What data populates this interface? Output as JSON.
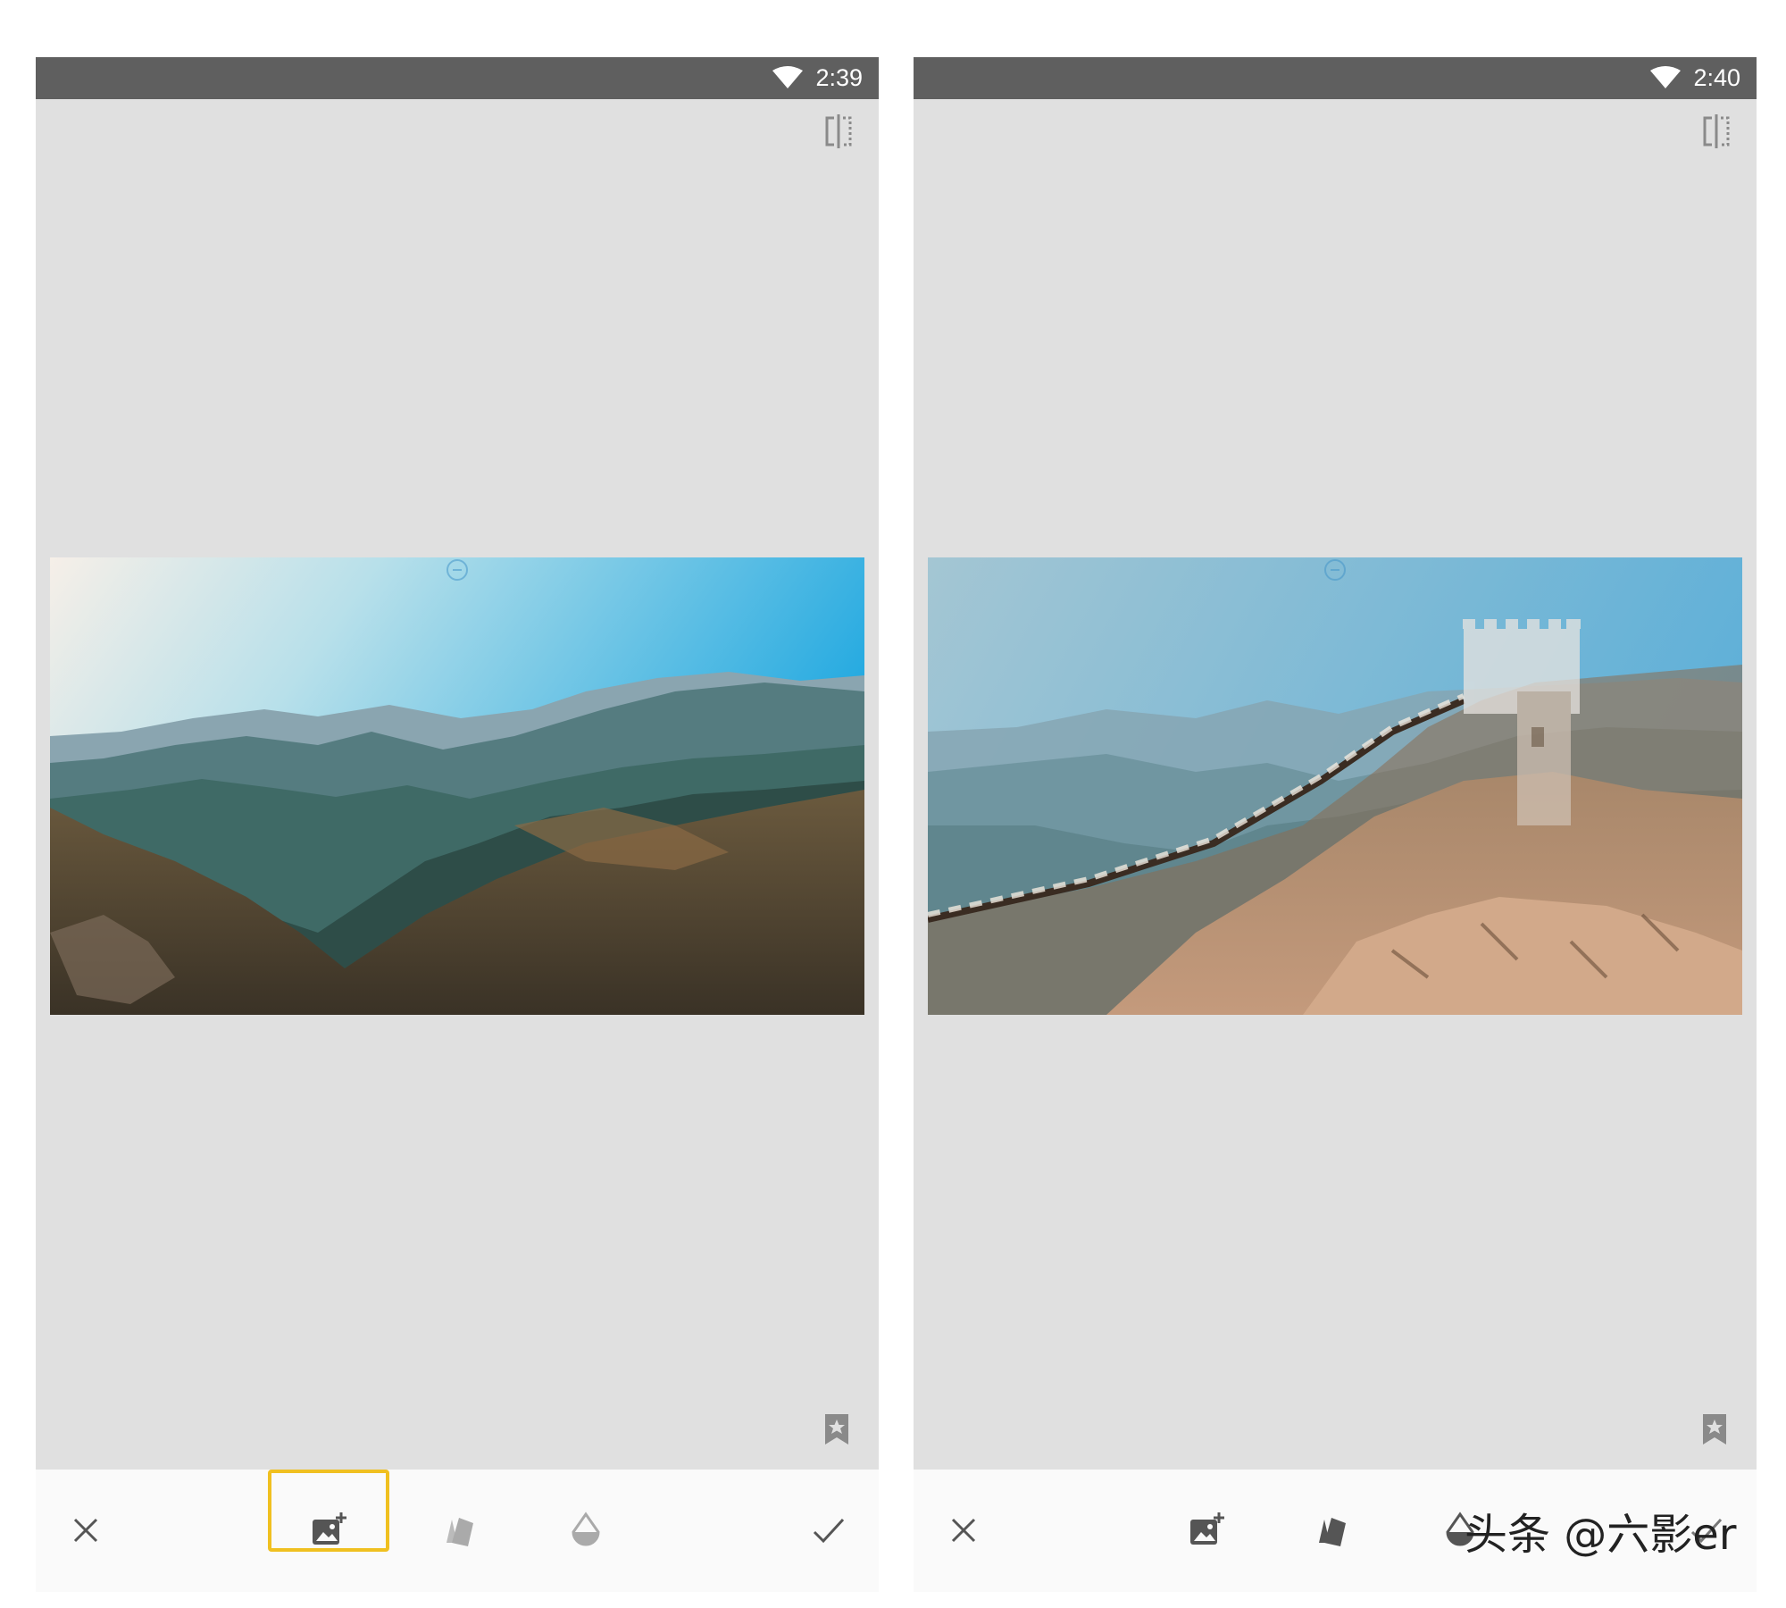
{
  "left_screen": {
    "status_time": "2:39",
    "active_tool": "add-image"
  },
  "right_screen": {
    "status_time": "2:40",
    "active_tool": ""
  },
  "toolbar": {
    "items": [
      {
        "icon": "close-icon"
      },
      {
        "icon": "add-image-icon"
      },
      {
        "icon": "blend-mode-icon"
      },
      {
        "icon": "opacity-icon"
      },
      {
        "icon": "check-icon"
      }
    ]
  },
  "watermark": "头条 @六影er",
  "colors": {
    "statusbar": "#5f5f5f",
    "canvas": "#e0e0e0",
    "highlight": "#f0c020",
    "toolbar": "#fafafa"
  }
}
